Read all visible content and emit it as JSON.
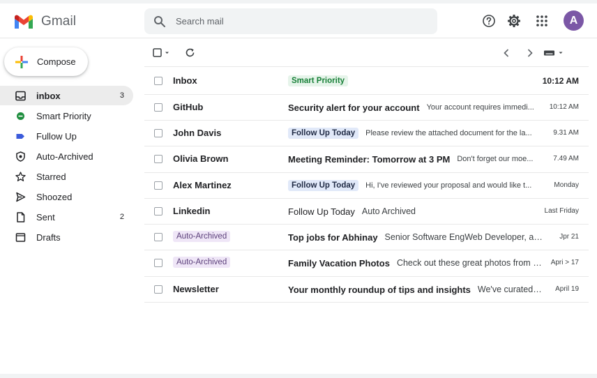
{
  "app": {
    "name": "Gmail"
  },
  "search": {
    "placeholder": "Search mail"
  },
  "header": {
    "avatar_letter": "A"
  },
  "compose": {
    "label": "Compose"
  },
  "sidebar": {
    "items": [
      {
        "label": "inbox",
        "count": "3",
        "icon": "inbox-icon",
        "active": true
      },
      {
        "label": "Smart Priority",
        "icon": "green-dot-icon"
      },
      {
        "label": "Fullow Up",
        "icon": "blue-tag-icon"
      },
      {
        "label": "Auto-Archived",
        "icon": "shield-icon"
      },
      {
        "label": "Starred",
        "icon": "star-icon"
      },
      {
        "label": "Shoozed",
        "icon": "send-arrow-icon"
      },
      {
        "label": "Sent",
        "count": "2",
        "icon": "file-icon"
      },
      {
        "label": "Drafts",
        "icon": "draft-icon"
      }
    ]
  },
  "emails": [
    {
      "sender": "Inbox",
      "tag": "Smart Priority",
      "tag_style": "green",
      "subject": "",
      "snippet": "",
      "time": "10:12 AM"
    },
    {
      "sender": "GitHub",
      "tag": "",
      "subject": "Security alert for your account",
      "snippet": "Your account requires immedi...",
      "time": "10:12 AM"
    },
    {
      "sender": "John Davis",
      "tag": "Follow Up Today",
      "tag_style": "blue",
      "subject": "",
      "snippet": "Please review the attached document for the la...",
      "time": "9.31 AM"
    },
    {
      "sender": "Olivia Brown",
      "tag": "",
      "subject": "Meeting Reminder: Tomorrow at 3 PM",
      "snippet": "Don't forget our moe...",
      "time": "7.49 AM"
    },
    {
      "sender": "Alex Martinez",
      "tag": "Follow Up Today",
      "tag_style": "blue",
      "subject": "",
      "snippet": "Hi, I've reviewed your proposal and would like t...",
      "time": "Monday"
    },
    {
      "sender": "Linkedin",
      "tag": "",
      "subject": "Follow Up Today",
      "snippet": "Auto Archived",
      "time": "Last Friday"
    },
    {
      "sender": "Auto-Archived",
      "tag": "",
      "subject": "Top jobs for Abhinay",
      "snippet": "Senior Software EngWeb Developer, and more",
      "time": "Jpr 21"
    },
    {
      "sender": "Auto-Archived",
      "tag": "",
      "subject": "Family Vacation Photos",
      "snippet": "Check out these great photos from me...",
      "time": "Apri > 17"
    },
    {
      "sender": "Newsletter",
      "tag": "",
      "subject": "Your monthly roundup of tips and insights",
      "snippet": "We've curated the",
      "time": "April 19"
    }
  ],
  "colors": {
    "accent_green": "#188038",
    "avatar": "#7b57a6",
    "active_nav": "#ececec"
  }
}
